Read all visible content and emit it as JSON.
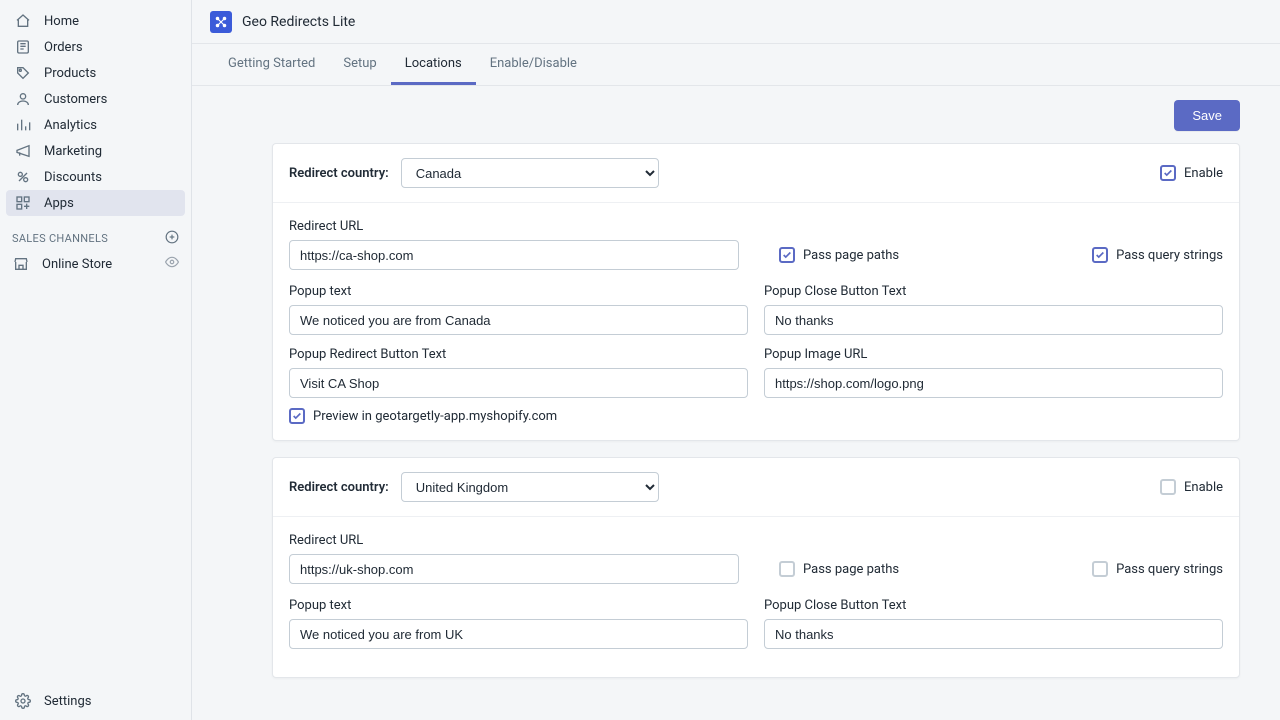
{
  "sidebar": {
    "items": [
      {
        "label": "Home",
        "icon": "home"
      },
      {
        "label": "Orders",
        "icon": "orders"
      },
      {
        "label": "Products",
        "icon": "products"
      },
      {
        "label": "Customers",
        "icon": "customers"
      },
      {
        "label": "Analytics",
        "icon": "analytics"
      },
      {
        "label": "Marketing",
        "icon": "marketing"
      },
      {
        "label": "Discounts",
        "icon": "discounts"
      },
      {
        "label": "Apps",
        "icon": "apps"
      }
    ],
    "section_header": "SALES CHANNELS",
    "channel": {
      "label": "Online Store"
    },
    "footer": {
      "label": "Settings"
    }
  },
  "header": {
    "app_title": "Geo Redirects Lite",
    "tabs": [
      "Getting Started",
      "Setup",
      "Locations",
      "Enable/Disable"
    ],
    "active_tab_index": 2,
    "save_label": "Save"
  },
  "labels": {
    "redirect_country": "Redirect country:",
    "enable": "Enable",
    "redirect_url": "Redirect URL",
    "pass_page_paths": "Pass page paths",
    "pass_query_strings": "Pass query strings",
    "popup_text": "Popup text",
    "popup_close_text": "Popup Close Button Text",
    "popup_redirect_button": "Popup Redirect Button Text",
    "popup_image_url": "Popup Image URL",
    "preview_prefix": "Preview in geotargetly-app.myshopify.com"
  },
  "cards": [
    {
      "country": "Canada",
      "enabled": true,
      "redirect_url": "https://ca-shop.com",
      "pass_page_paths": true,
      "pass_query_strings": true,
      "popup_text": "We noticed you are from Canada",
      "popup_close_text": "No thanks",
      "popup_redirect_button": "Visit CA Shop",
      "popup_image_url": "https://shop.com/logo.png",
      "preview_checked": true
    },
    {
      "country": "United Kingdom",
      "enabled": false,
      "redirect_url": "https://uk-shop.com",
      "pass_page_paths": false,
      "pass_query_strings": false,
      "popup_text": "We noticed you are from UK",
      "popup_close_text": "No thanks",
      "popup_redirect_button": "",
      "popup_image_url": "",
      "preview_checked": false
    }
  ]
}
